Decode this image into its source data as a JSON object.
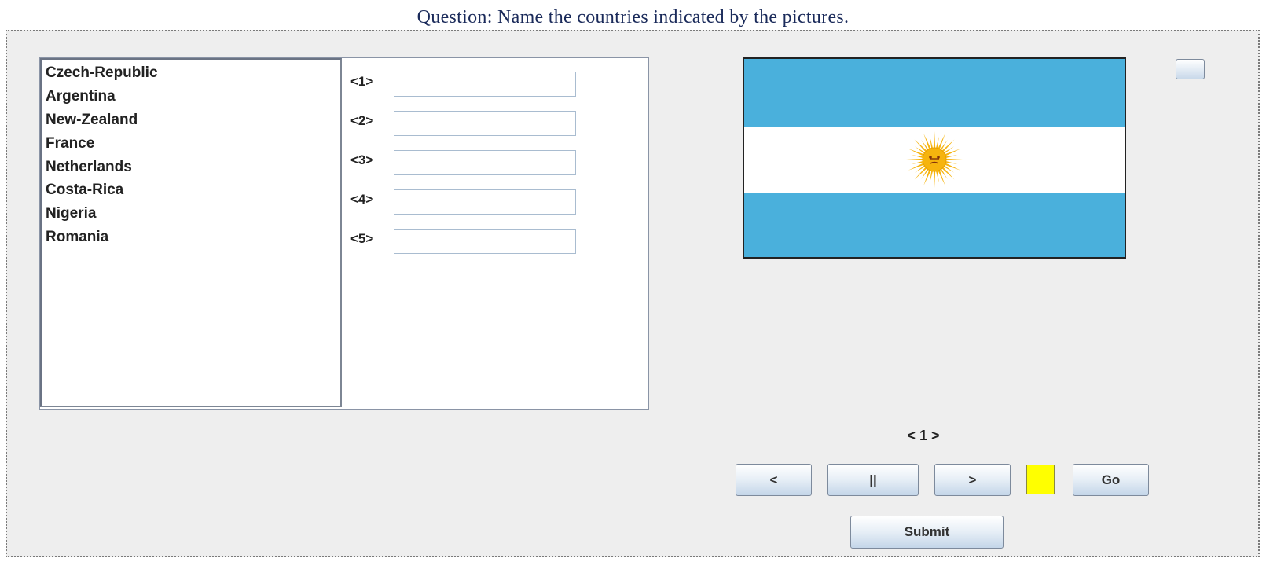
{
  "question": "Question: Name the countries indicated by the pictures.",
  "countries": [
    "Czech-Republic",
    "Argentina",
    "New-Zealand",
    "France",
    "Netherlands",
    "Costa-Rica",
    "Nigeria",
    "Romania"
  ],
  "answers": [
    {
      "label": "<1>",
      "value": ""
    },
    {
      "label": "<2>",
      "value": ""
    },
    {
      "label": "<3>",
      "value": ""
    },
    {
      "label": "<4>",
      "value": ""
    },
    {
      "label": "<5>",
      "value": ""
    }
  ],
  "flag": {
    "country": "Argentina",
    "colors": {
      "blue": "#4ab0dc",
      "white": "#ffffff",
      "sun": "#f6b40e"
    }
  },
  "page_indicator": "< 1 >",
  "controls": {
    "prev_label": "<",
    "pause_label": "||",
    "next_label": ">",
    "go_label": "Go",
    "submit_label": "Submit",
    "status_color": "#ffff00"
  }
}
